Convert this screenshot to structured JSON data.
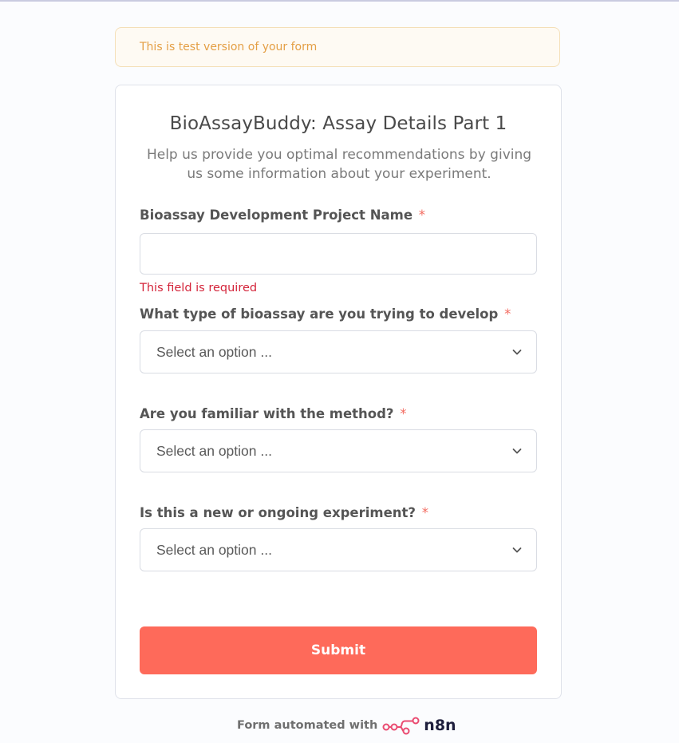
{
  "banner": {
    "text": "This is test version of your form"
  },
  "form": {
    "title": "BioAssayBuddy: Assay Details Part 1",
    "subtitle": "Help us provide you optimal recommendations by giving us some information about your experiment.",
    "required_marker": "*",
    "fields": [
      {
        "label": "Bioassay Development Project Name",
        "type": "text",
        "value": "",
        "error": "This field is required"
      },
      {
        "label": "What type of bioassay are you trying to develop",
        "type": "select",
        "selected": "Select an option ..."
      },
      {
        "label": "Are you familiar with the method?",
        "type": "select",
        "selected": "Select an option ..."
      },
      {
        "label": "Is this a new or ongoing experiment?",
        "type": "select",
        "selected": "Select an option ..."
      }
    ],
    "submit_label": "Submit"
  },
  "footer": {
    "text": "Form automated with",
    "brand": "n8n",
    "logo_icon": "n8n-logo-icon"
  },
  "colors": {
    "accent": "#fe6a5a",
    "error": "#d4243a",
    "banner_text": "#e49f45",
    "banner_bg": "#fefaf3",
    "required": "#f36b60",
    "n8n_brand": "#ea4b71"
  }
}
